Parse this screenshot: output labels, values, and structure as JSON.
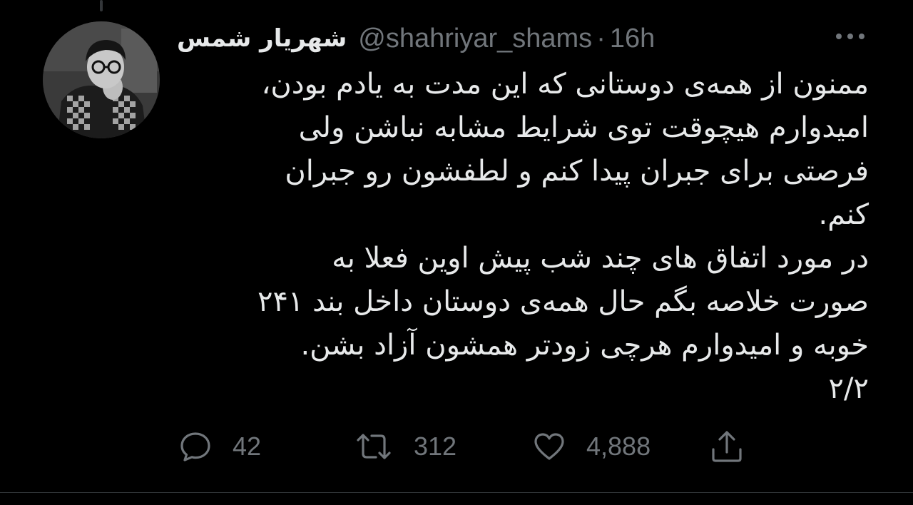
{
  "tweet": {
    "display_name": "شهریار شمس",
    "handle": "@shahriyar_shams",
    "separator": "·",
    "time": "16h",
    "paragraphs": [
      "ممنون از همه‌ی دوستانی که این مدت به یادم بودن،\nامیدوارم هیچوقت توی شرایط مشابه نباشن ولی\nفرصتی برای جبران پیدا کنم و لطفشون رو جبران\nکنم.",
      "در مورد اتفاق های چند شب پیش اوین فعلا به\nصورت خلاصه بگم حال همه‌ی دوستان داخل بند ۲۴۱\nخوبه و امیدوارم هرچی زودتر همشون آزاد بشن.\n۲/۲"
    ]
  },
  "actions": {
    "reply": {
      "icon": "reply-icon",
      "count": "42"
    },
    "retweet": {
      "icon": "retweet-icon",
      "count": "312"
    },
    "like": {
      "icon": "heart-icon",
      "count": "4,888"
    },
    "share": {
      "icon": "share-icon"
    }
  },
  "colors": {
    "background": "#000000",
    "text": "#e7e9ea",
    "secondary_text": "#71767b",
    "divider": "#2f3336"
  }
}
